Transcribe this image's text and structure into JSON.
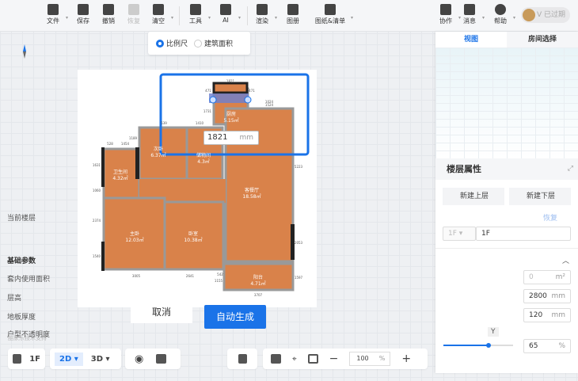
{
  "toolbar": {
    "items": [
      {
        "label": "文件",
        "icon": "file-icon"
      },
      {
        "label": "保存",
        "icon": "save-icon"
      },
      {
        "label": "撤销",
        "icon": "undo-icon"
      },
      {
        "label": "恢复",
        "icon": "redo-icon"
      },
      {
        "label": "清空",
        "icon": "eraser-icon"
      },
      {
        "label": "工具",
        "icon": "wrench-icon"
      },
      {
        "label": "AI",
        "icon": "ai-icon"
      },
      {
        "label": "渲染",
        "icon": "camera-icon"
      },
      {
        "label": "图册",
        "icon": "album-icon"
      },
      {
        "label": "图纸&清单",
        "icon": "drawing-list-icon"
      }
    ],
    "right": [
      {
        "label": "协作",
        "icon": "users-icon"
      },
      {
        "label": "消息",
        "icon": "bell-icon"
      },
      {
        "label": "帮助",
        "icon": "help-icon"
      }
    ],
    "expired": "V 已过期"
  },
  "scale_mode": {
    "options": [
      "比例尺",
      "建筑面积"
    ],
    "selected": "比例尺"
  },
  "plan": {
    "rooms": [
      {
        "name": "厨房",
        "area": "5.15㎡"
      },
      {
        "name": "次卧",
        "area": "6.37㎡"
      },
      {
        "name": "储物间",
        "area": "4.3㎡"
      },
      {
        "name": "卫生间",
        "area": "4.32㎡"
      },
      {
        "name": "客餐厅",
        "area": "18.58㎡"
      },
      {
        "name": "主卧",
        "area": "12.03㎡"
      },
      {
        "name": "卧室",
        "area": "10.38㎡"
      },
      {
        "name": "阳台",
        "area": "4.71㎡"
      }
    ],
    "dims": [
      "1821",
      "471",
      "471",
      "1731",
      "1524",
      "1024",
      "539",
      "1410",
      "1189",
      "528",
      "1454",
      "1631",
      "1060",
      "2374",
      "1540",
      "3005",
      "2641",
      "542",
      "1155",
      "5223",
      "2053",
      "1597",
      "3707"
    ]
  },
  "scale_input": {
    "value": "1821",
    "unit": "mm"
  },
  "actions": {
    "cancel": "取消",
    "generate": "自动生成"
  },
  "support": "酷家乐技术支持",
  "bottom": {
    "floor": "1F",
    "mode2d": "2D",
    "mode3d": "3D",
    "zoom": "100",
    "zoom_unit": "%"
  },
  "panel": {
    "tabs": [
      "视图",
      "房间选择"
    ],
    "title": "楼层属性",
    "add_upper": "新建上层",
    "add_lower": "新建下层",
    "current_floor_label": "当前楼层",
    "restore": "恢复",
    "floor_select": "1F",
    "floor_name": "1F",
    "section": "基础参数",
    "inner_area_label": "套内使用面积",
    "inner_area": "0",
    "inner_area_unit": "m²",
    "height_label": "层高",
    "height": "2800",
    "height_unit": "mm",
    "thickness_label": "地板厚度",
    "thickness": "120",
    "thickness_unit": "mm",
    "opacity_label": "户型不透明度",
    "opacity_key": "Y",
    "opacity": "65",
    "opacity_unit": "%"
  },
  "colors": {
    "accent": "#1a73e8",
    "floor": "#d9824a"
  }
}
